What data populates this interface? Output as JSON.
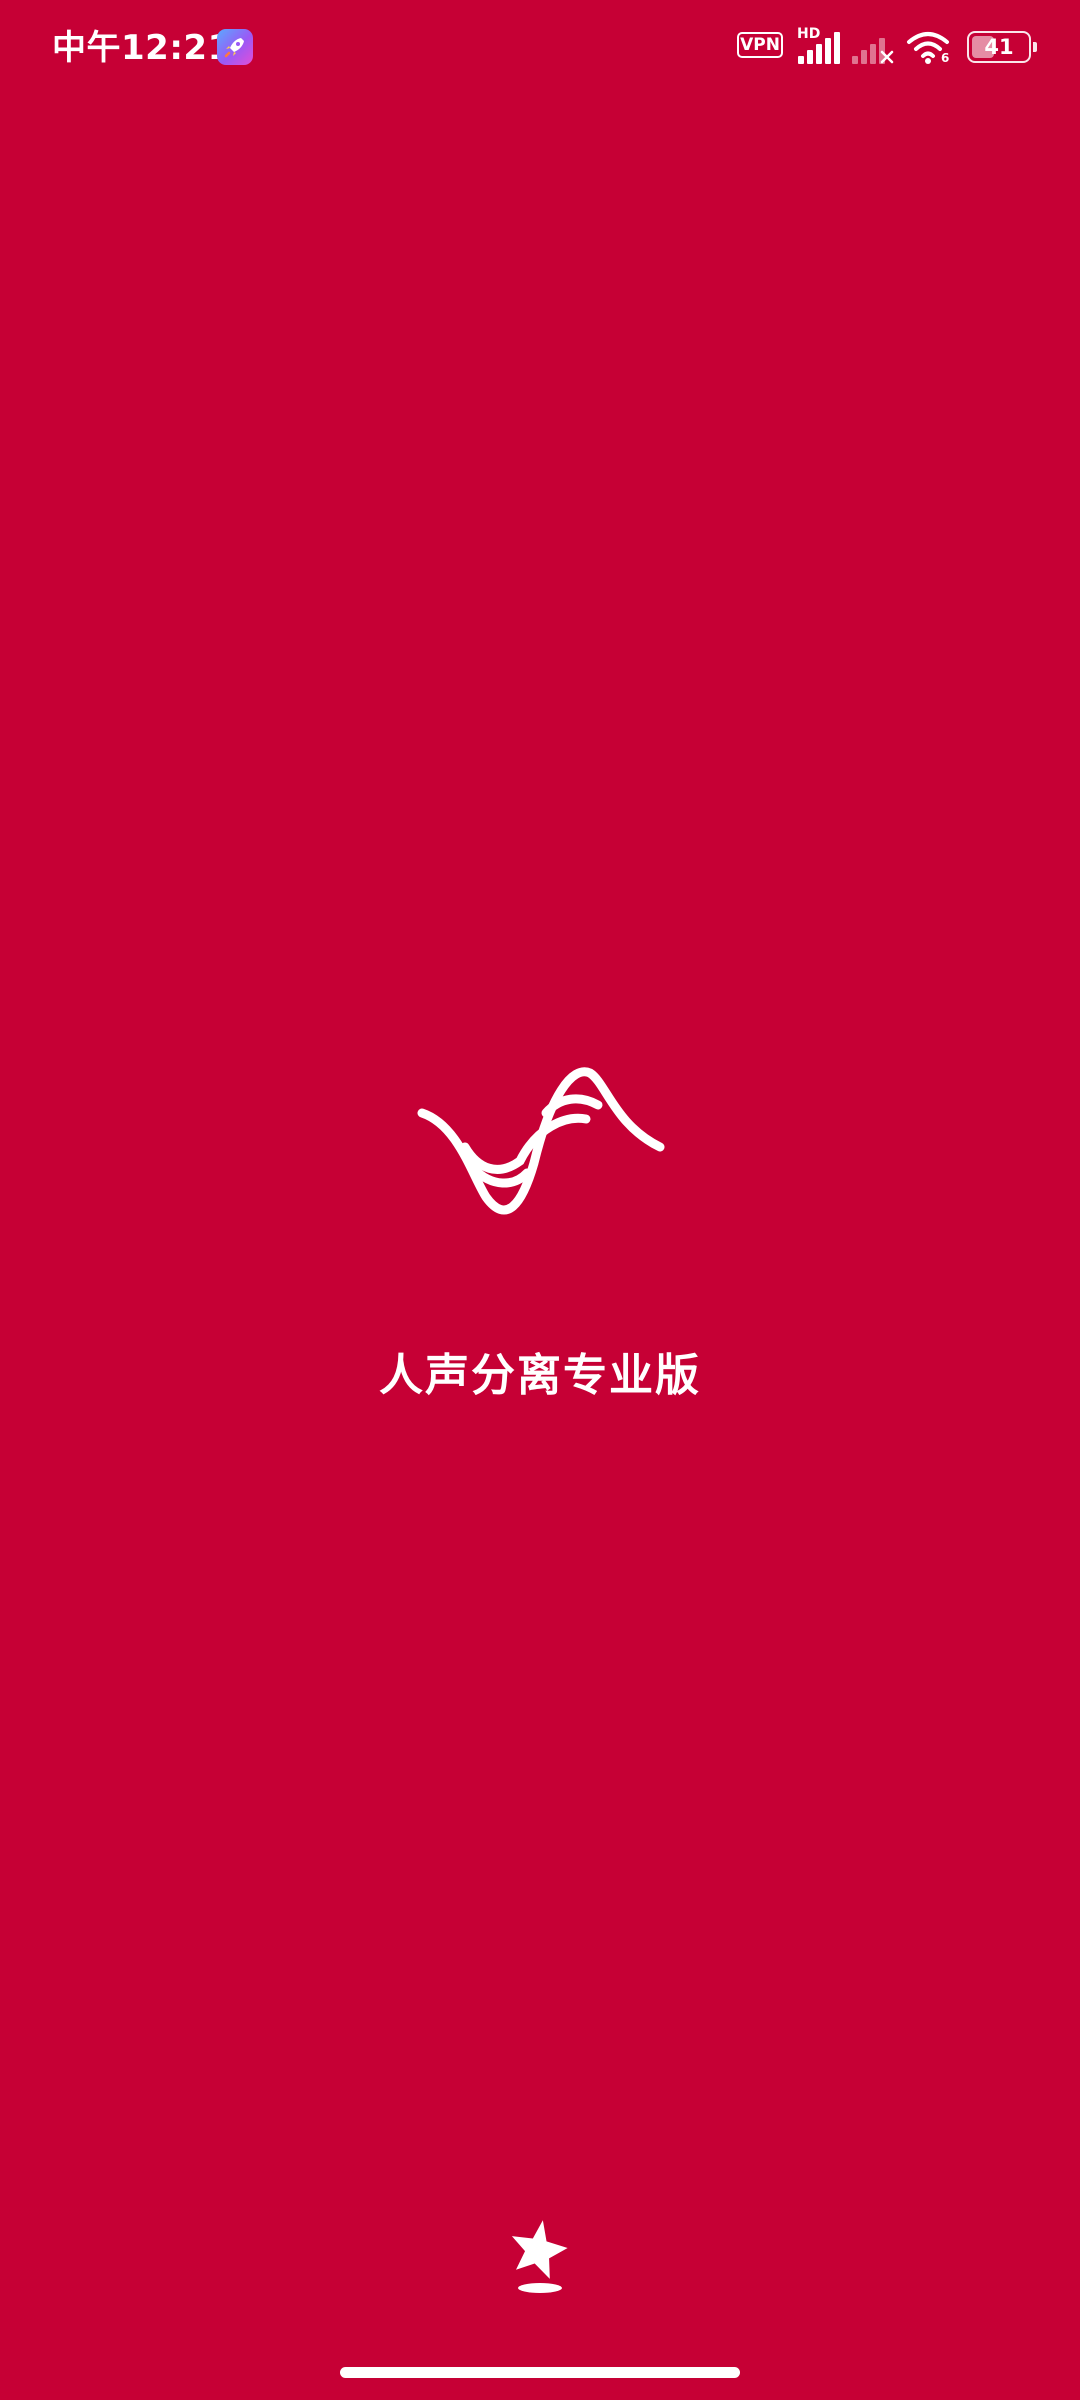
{
  "status_bar": {
    "time": "中午12:21",
    "vpn_label": "VPN",
    "network_label": "HD",
    "wifi_number": "6",
    "battery_percent": 41
  },
  "splash": {
    "app_name": "人声分离专业版",
    "logo_icon": "sound-wave-logo-icon",
    "bottom_icon": "star-brand-icon"
  },
  "colors": {
    "background": "#C60035",
    "foreground": "#FFFFFF"
  }
}
